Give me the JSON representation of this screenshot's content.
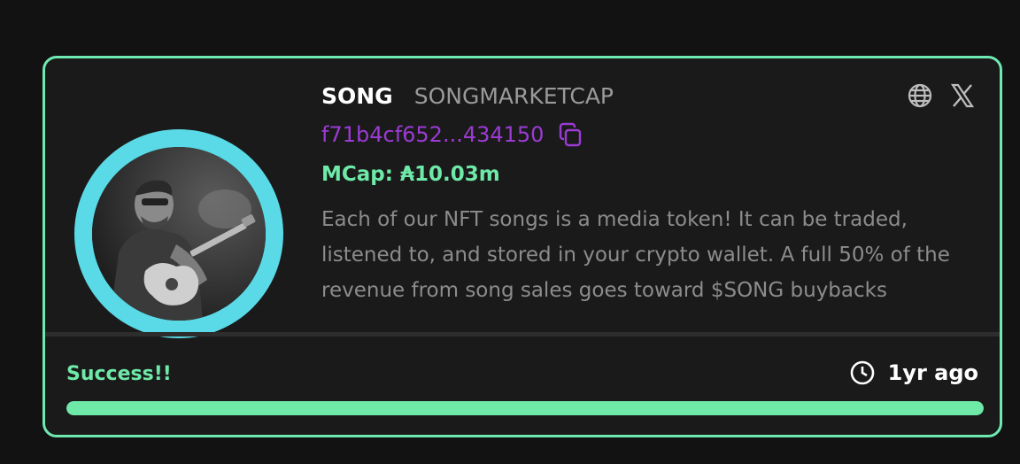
{
  "token": {
    "ticker": "SONG",
    "name": "SONGMARKETCAP",
    "address": "f71b4cf652...434150",
    "market_cap": "MCap: ₳10.03m",
    "description": "Each of our NFT songs is a media token! It can be traded, listened to, and stored in your crypto wallet. A full 50% of the revenue from song sales goes toward $SONG buybacks"
  },
  "icons": {
    "copy": "copy-icon",
    "website": "globe-icon",
    "twitter": "x-icon",
    "clock": "clock-icon",
    "avatar": "guitarist-photo"
  },
  "footer": {
    "status": "Success!!",
    "time": "1yr ago",
    "progress": 1.0
  },
  "colors": {
    "accent_green": "#6ee9a8",
    "ring_cyan": "#5ad9e6",
    "address_purple": "#9b3bd4",
    "background": "#121212",
    "card": "#1a1a1a"
  }
}
